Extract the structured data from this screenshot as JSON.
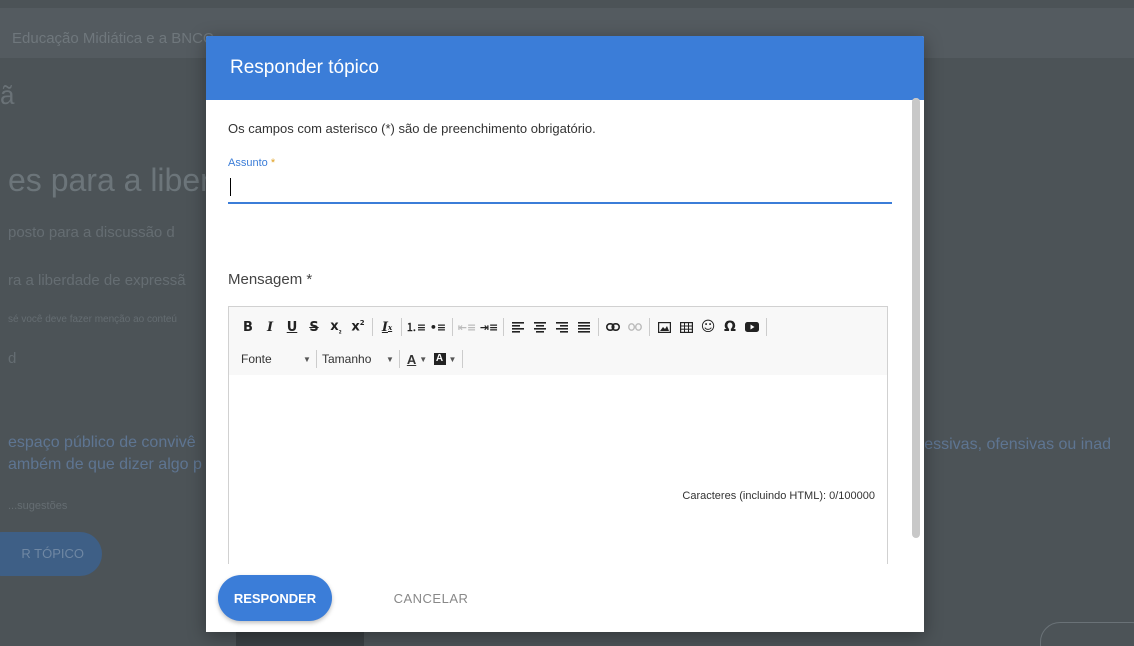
{
  "background": {
    "breadcrumb": "Educação Midiática e a BNCC",
    "char": "ã",
    "heading": "es para a liberda",
    "lines": [
      "posto para a discussão d",
      "ra a liberdade de expressã",
      "sé você deve fazer menção ao conteú",
      "d",
      "espaço público de convivê",
      "ambém de que dizer algo p",
      "...sugestões"
    ],
    "right_text": "gressivas, ofensivas ou inad",
    "button_label": "R TÓPICO"
  },
  "modal": {
    "title": "Responder tópico",
    "required_note": "Os campos com asterisco (*) são de preenchimento obrigatório.",
    "subject_label": "Assunto",
    "subject_value": "",
    "message_label": "Mensagem *",
    "char_count": "Caracteres (incluindo HTML): 0/100000",
    "font_combo": "Fonte",
    "size_combo": "Tamanho"
  },
  "footer": {
    "submit_label": "RESPONDER",
    "cancel_label": "CANCELAR"
  },
  "colors": {
    "accent": "#3b7dd8",
    "backdrop": "#4c5357",
    "required_asterisk": "#e0a020"
  },
  "toolbar_icons": [
    "bold-icon",
    "italic-icon",
    "underline-icon",
    "strikethrough-icon",
    "subscript-icon",
    "superscript-icon",
    "remove-format-icon",
    "numbered-list-icon",
    "bulleted-list-icon",
    "outdent-icon",
    "indent-icon",
    "align-left-icon",
    "align-center-icon",
    "align-right-icon",
    "justify-icon",
    "link-icon",
    "unlink-icon",
    "image-icon",
    "table-icon",
    "smiley-icon",
    "special-char-icon",
    "video-icon",
    "text-color-icon",
    "background-color-icon"
  ]
}
